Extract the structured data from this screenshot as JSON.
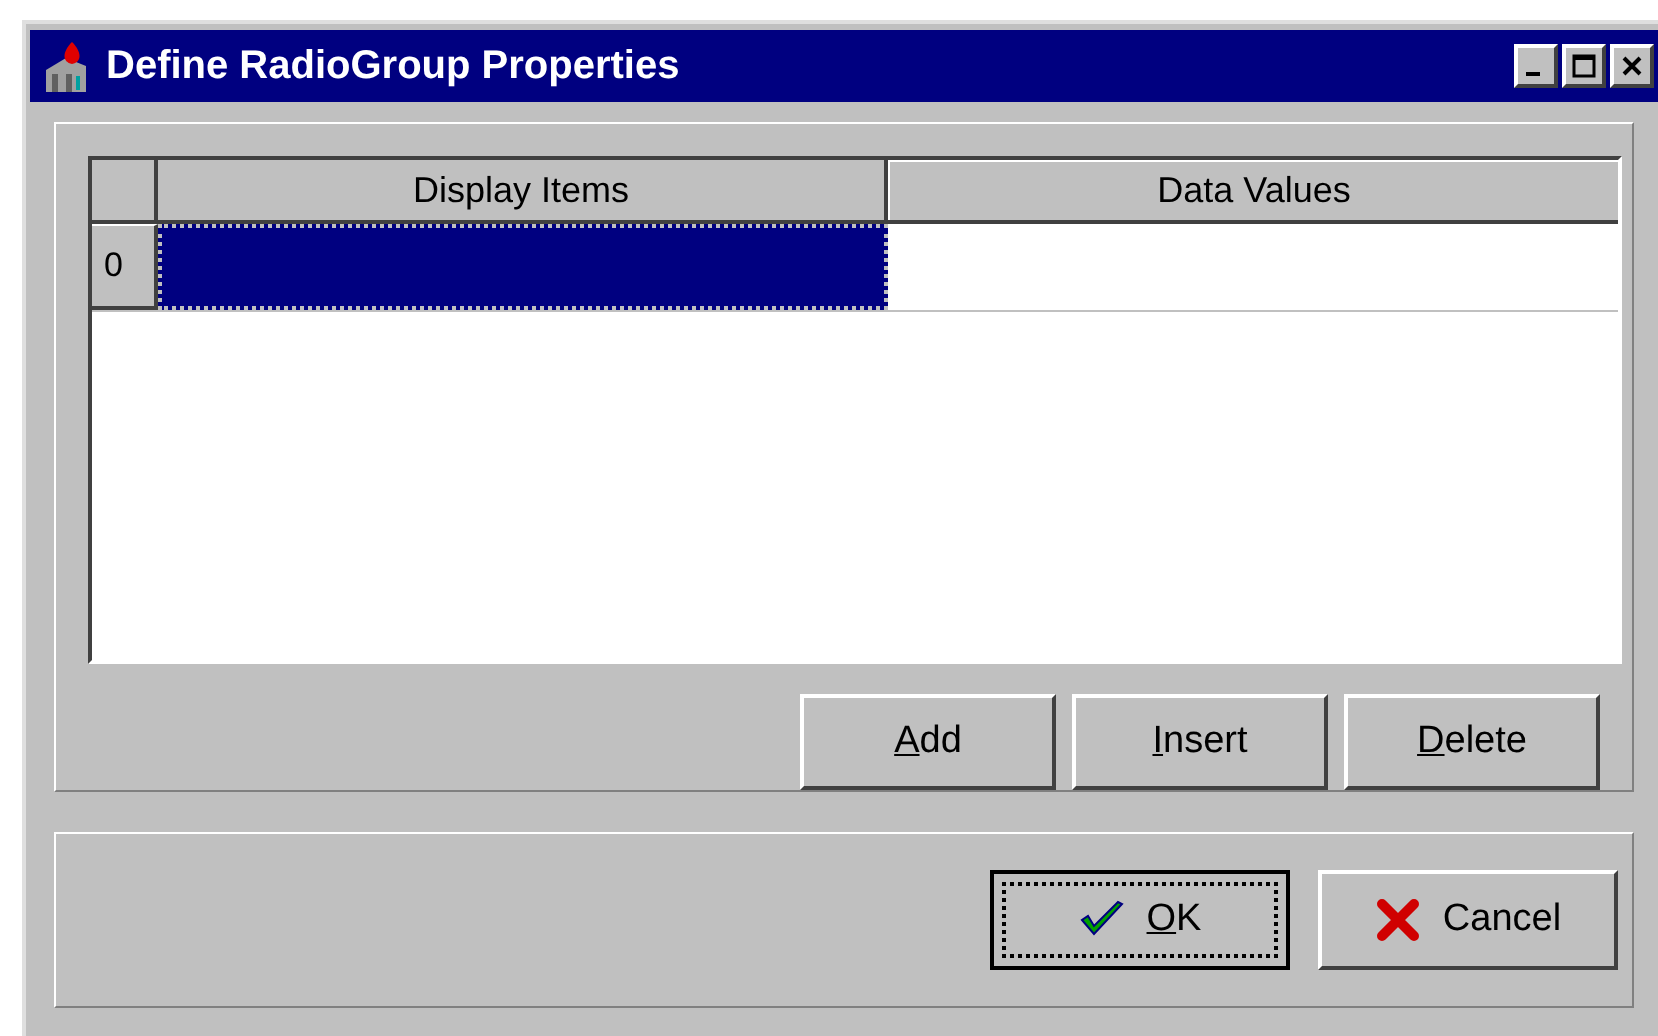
{
  "window": {
    "title": "Define RadioGroup Properties",
    "controls": [
      {
        "kind": "minimize"
      },
      {
        "kind": "maximize"
      },
      {
        "kind": "close"
      }
    ]
  },
  "grid": {
    "columns": [
      "Display Items",
      "Data Values"
    ],
    "rows": [
      {
        "header": "0",
        "cells": [
          {
            "selected": true
          },
          {
            "selected": false
          }
        ]
      }
    ]
  },
  "row_buttons": [
    {
      "label": "Add",
      "underline_first": true
    },
    {
      "label": "Insert",
      "underline_first": true
    },
    {
      "label": "Delete",
      "underline_first": true
    }
  ],
  "dialog_buttons": [
    {
      "label": "OK",
      "kind": "ok",
      "underline_first": true,
      "default": true
    },
    {
      "label": "Cancel",
      "kind": "cancel",
      "underline_first": false,
      "default": false
    }
  ]
}
